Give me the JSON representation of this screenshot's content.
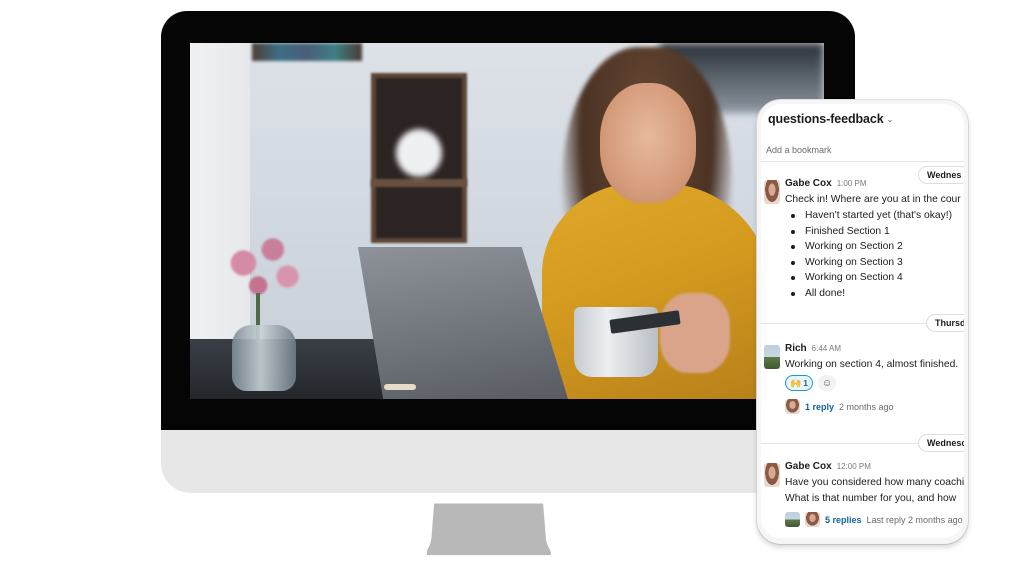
{
  "scene": {
    "description": "Desktop monitor showing a photo of a smiling woman at a laptop holding a mug and card, with a phone mockup showing a chat channel",
    "colors": {
      "bezel": "#050505",
      "chin": "#e7e7e7",
      "stand": "#b8b8b8",
      "link": "#1264a3",
      "reaction_border": "#1d9bd1"
    }
  },
  "phone": {
    "channel": {
      "name": "questions-feedback",
      "chevron_icon": "chevron-down-icon",
      "bookmark_label": "Add a bookmark"
    },
    "date_dividers": [
      "Wednes",
      "Thursd",
      "Wednesc"
    ],
    "messages": [
      {
        "author": "Gabe Cox",
        "time": "1:00 PM",
        "text": "Check in! Where are you at in the cour",
        "bullets": [
          "Haven't started yet (that's okay!)",
          "Finished Section 1",
          "Working on Section 2",
          "Working on Section 3",
          "Working on Section 4",
          "All done!"
        ]
      },
      {
        "author": "Rich",
        "time": "6:44 AM",
        "text": "Working on section 4, almost finished.",
        "reaction": {
          "emoji": "raised-hands",
          "glyph": "🙌",
          "count": "1"
        },
        "add_reaction_icon": "add-reaction-icon",
        "thread": {
          "replies": "1 reply",
          "last": "2 months ago"
        }
      },
      {
        "author": "Gabe Cox",
        "time": "12:00 PM",
        "lines": [
          "Have you considered how many coachi",
          "What is that number for you, and how"
        ],
        "thread": {
          "replies": "5 replies",
          "last": "Last reply 2 months ago"
        }
      }
    ]
  }
}
